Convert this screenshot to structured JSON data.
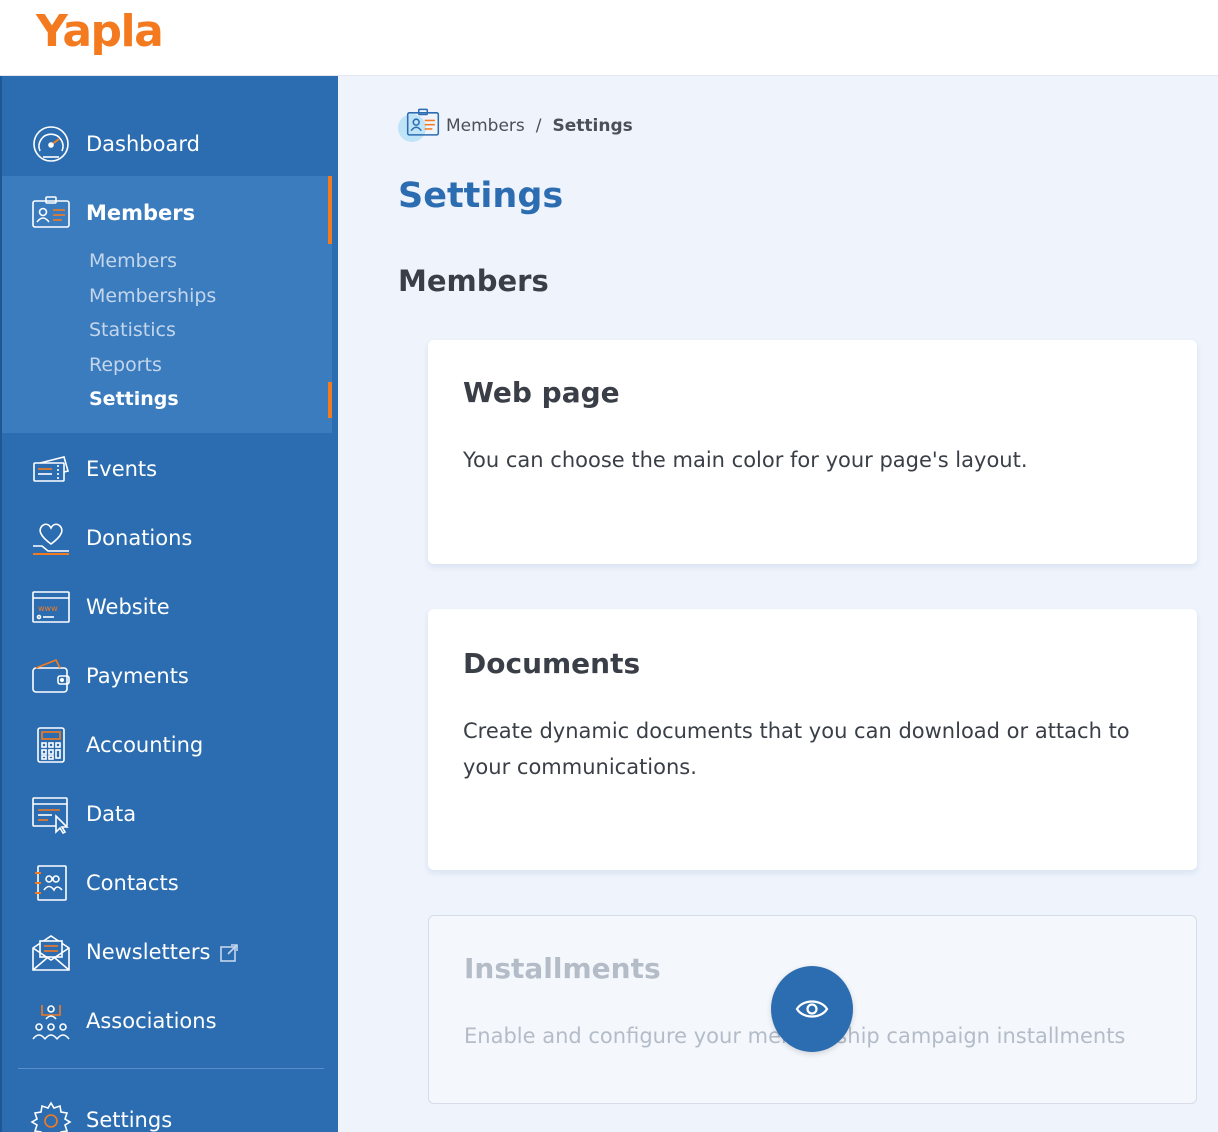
{
  "brand": {
    "logo_text": "Yapla",
    "accent_color": "#f47a20",
    "primary_color": "#2b6db0"
  },
  "sidebar": {
    "items": [
      {
        "label": "Dashboard",
        "icon": "speedometer-icon"
      },
      {
        "label": "Members",
        "icon": "member-card-icon"
      },
      {
        "label": "Events",
        "icon": "tickets-icon"
      },
      {
        "label": "Donations",
        "icon": "heart-hand-icon"
      },
      {
        "label": "Website",
        "icon": "browser-www-icon"
      },
      {
        "label": "Payments",
        "icon": "wallet-icon"
      },
      {
        "label": "Accounting",
        "icon": "calculator-icon"
      },
      {
        "label": "Data",
        "icon": "data-cursor-icon"
      },
      {
        "label": "Contacts",
        "icon": "address-book-icon"
      },
      {
        "label": "Newsletters",
        "icon": "envelope-icon"
      },
      {
        "label": "Associations",
        "icon": "people-network-icon"
      },
      {
        "label": "Settings",
        "icon": "gear-icon"
      }
    ],
    "members_subitems": [
      {
        "label": "Members"
      },
      {
        "label": "Memberships"
      },
      {
        "label": "Statistics"
      },
      {
        "label": "Reports"
      },
      {
        "label": "Settings",
        "active": true
      }
    ]
  },
  "breadcrumb": {
    "parent": "Members",
    "separator": "/",
    "current": "Settings"
  },
  "page": {
    "title": "Settings",
    "section_title": "Members"
  },
  "cards": [
    {
      "title": "Web page",
      "description": "You can choose the main color for your page's layout."
    },
    {
      "title": "Documents",
      "description": "Create dynamic documents that you can download or attach to your communications."
    },
    {
      "title": "Installments",
      "description": "Enable and configure your membership campaign installments",
      "disabled": true
    }
  ],
  "fab": {
    "icon": "eye-icon"
  }
}
